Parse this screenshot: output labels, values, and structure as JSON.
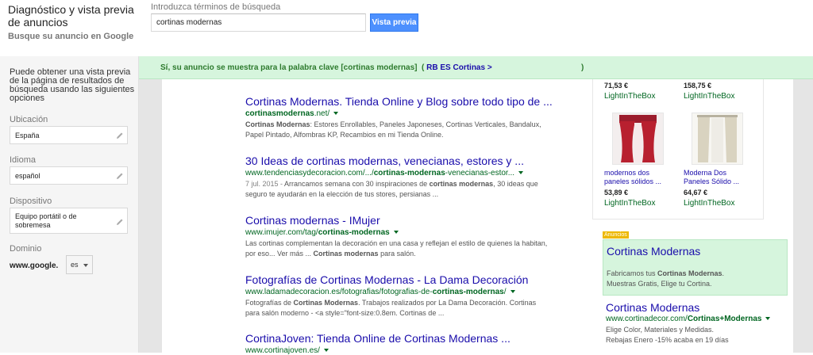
{
  "header": {
    "title": "Diagnóstico y vista previa de anuncios",
    "subtitle": "Busque su anuncio en Google"
  },
  "search": {
    "label": "Introduzca términos de búsqueda",
    "value": "cortinas modernas",
    "button_label": "Vista previa"
  },
  "sidebar": {
    "description": "Puede obtener una vista previa de la página de resultados de búsqueda usando las siguientes opciones",
    "location_label": "Ubicación",
    "location_value": "España",
    "language_label": "Idioma",
    "language_value": "español",
    "device_label": "Dispositivo",
    "device_value": "Equipo portátil o de sobremesa",
    "domain_label": "Dominio",
    "domain_prefix": "www.google.",
    "domain_value": "es"
  },
  "banner": {
    "text": "Sí, su anuncio se muestra para la palabra clave [cortinas modernas]",
    "paren_open": "(",
    "link": "RB ES Cortinas",
    "chevron": ">",
    "paren_close": ")"
  },
  "results": [
    {
      "title": "Cortinas Modernas. Tienda Online y Blog sobre todo tipo de ...",
      "url_plain": "",
      "url_bold": "cortinasmodernas",
      "url_after": ".net/",
      "snippet_bold": "Cortinas Modernas",
      "snippet": ": Estores Enrollables, Paneles Japoneses, Cortinas Verticales, Bandalux, Papel Pintado, Alfombras KP, Recambios en mi Tienda Online."
    },
    {
      "title": "30 Ideas de cortinas modernas, venecianas, estores y ...",
      "url_plain": "www.tendenciasydecoracion.com/.../",
      "url_bold": "cortinas-modernas",
      "url_after": "-venecianas-estor...",
      "date": "7 jul. 2015 - ",
      "snippet_pre": "Arrancamos semana con 30 inspiraciones de ",
      "snippet_bold": "cortinas modernas",
      "snippet": ", 30 ideas que seguro te ayudarán en la elección de tus stores, persianas ..."
    },
    {
      "title": "Cortinas modernas - IMujer",
      "url_plain": "www.imujer.com/tag/",
      "url_bold": "cortinas-modernas",
      "url_after": "",
      "snippet_pre": "Las cortinas complementan la decoración en una casa y reflejan el estilo de quienes la habitan, por eso... Ver más ... ",
      "snippet_bold": "Cortinas modernas",
      "snippet": " para salón."
    },
    {
      "title": "Fotografías de Cortinas Modernas - La Dama Decoración",
      "url_plain": "www.ladamadecoracion.es/fotografias/fotografias-de-",
      "url_bold": "cortinas-modernas",
      "url_after": "/",
      "snippet_pre": "Fotografías de ",
      "snippet_bold": "Cortinas Modernas",
      "snippet": ". Trabajos realizados por La Dama Decoración. Cortinas para salón moderno - <a style=\"font-size:0.8em. Cortinas de ..."
    },
    {
      "title": "CortinaJoven: Tienda Online de Cortinas Modernas ...",
      "url_plain": "www.cortinajoven.es/",
      "url_bold": "",
      "url_after": ""
    }
  ],
  "shopping": {
    "top": [
      {
        "price": "71,53 €",
        "seller": "LightInTheBox"
      },
      {
        "price": "158,75 €",
        "seller": "LightInTheBox"
      }
    ],
    "items": [
      {
        "name": "modernos dos paneles sólidos ...",
        "price": "53,89 €",
        "seller": "LightInTheBox",
        "color": "#9b1c2c"
      },
      {
        "name": "Moderna Dos Paneles Sólido ...",
        "price": "64,67 €",
        "seller": "LightInTheBox",
        "color": "#d9d3c0"
      }
    ]
  },
  "ads": {
    "badge": "Anuncios",
    "ad1": {
      "title": "Cortinas Modernas",
      "desc_pre": "Fabricamos tus ",
      "desc_bold": "Cortinas Modernas",
      "desc_post": ".",
      "desc_line2": "Muestras Gratis, Elige tu Cortina."
    },
    "ad2": {
      "title": "Cortinas Modernas",
      "url_plain": "www.cortinadecor.com/",
      "url_bold": "Cortinas+Modernas",
      "line1": "Elige Color, Materiales y Medidas.",
      "line2": "Rebajas Enero -15% acaba en 19 días"
    }
  },
  "colors": {
    "link": "#1a0dab",
    "url": "#006621",
    "banner_bg": "#d6f5dd",
    "button": "#4d90fe",
    "ads_badge": "#edb802"
  }
}
